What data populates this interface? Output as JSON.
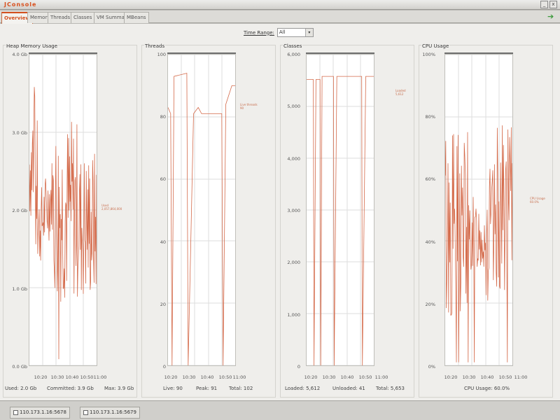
{
  "window": {
    "title": "JConsole",
    "button_min": "_",
    "button_close": "x"
  },
  "tabs": [
    {
      "label": "Overview",
      "active": true
    },
    {
      "label": "Memory",
      "active": false
    },
    {
      "label": "Threads",
      "active": false
    },
    {
      "label": "Classes",
      "active": false
    },
    {
      "label": "VM Summary",
      "active": false
    },
    {
      "label": "MBeans",
      "active": false
    }
  ],
  "time_range": {
    "label": "Time Range:",
    "value": "All",
    "arrow": "▾"
  },
  "panels": {
    "heap": {
      "title": "Heap Memory Usage",
      "y_ticks": [
        "4.0 Gb",
        "3.0 Gb",
        "2.0 Gb",
        "1.0 Gb",
        "0.0 Gb"
      ],
      "x_ticks": [
        "10:20",
        "10:30",
        "10:40",
        "10:50",
        "11:00"
      ],
      "legend": [
        "Used",
        "2,057,864,000"
      ],
      "footer": [
        "Used: 2.0 Gb",
        "Committed: 3.9 Gb",
        "Max: 3.9 Gb"
      ]
    },
    "threads": {
      "title": "Threads",
      "y_ticks": [
        "100",
        "80",
        "60",
        "40",
        "20",
        "0"
      ],
      "x_ticks": [
        "10:20",
        "10:30",
        "10:40",
        "10:50",
        "11:00"
      ],
      "legend": [
        "Live threads",
        "90"
      ],
      "footer": [
        "Live: 90",
        "Peak: 91",
        "Total: 102"
      ]
    },
    "classes": {
      "title": "Classes",
      "y_ticks": [
        "6,000",
        "5,000",
        "4,000",
        "3,000",
        "2,000",
        "1,000",
        "0"
      ],
      "x_ticks": [
        "10:20",
        "10:30",
        "10:40",
        "10:50",
        "11:00"
      ],
      "legend": [
        "Loaded",
        "5,612"
      ],
      "footer": [
        "Loaded: 5,612",
        "Unloaded: 41",
        "Total: 5,653"
      ]
    },
    "cpu": {
      "title": "CPU Usage",
      "y_ticks": [
        "100%",
        "80%",
        "60%",
        "40%",
        "20%",
        "0%"
      ],
      "x_ticks": [
        "10:20",
        "10:30",
        "10:40",
        "10:50",
        "11:00"
      ],
      "legend": [
        "CPU Usage",
        "60.0%"
      ],
      "footer": [
        "CPU Usage: 60.0%"
      ]
    }
  },
  "taskbar": [
    {
      "label": "110.173.1.16:5678"
    },
    {
      "label": "110.173.1.16:5679"
    }
  ],
  "colors": {
    "series": "#d46a4a",
    "accent": "#d3501f",
    "grid": "#dddddd"
  },
  "icons": {
    "detach": "detach-icon"
  }
}
